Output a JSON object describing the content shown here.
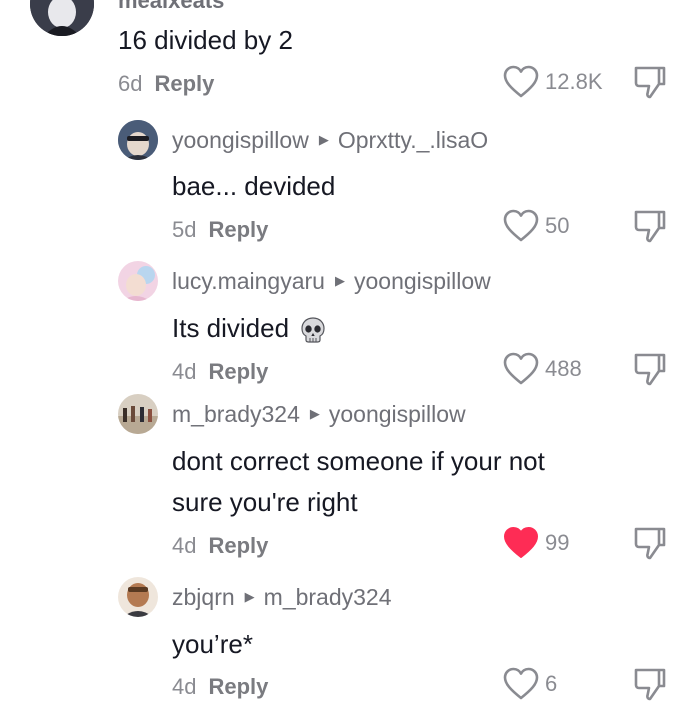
{
  "top_comment": {
    "username": "mealxeats",
    "text": "16 divided by 2",
    "age": "6d",
    "reply_label": "Reply",
    "likes": "12.8K"
  },
  "replies": [
    {
      "user": "yoongispillow",
      "reply_to": "Oprxtty._.lisaO",
      "text": "bae... devided",
      "age": "5d",
      "reply_label": "Reply",
      "likes": "50",
      "liked": false
    },
    {
      "user": "lucy.maingyaru",
      "reply_to": "yoongispillow",
      "text": "Its divided",
      "emoji_icon": "skull-icon",
      "age": "4d",
      "reply_label": "Reply",
      "likes": "488",
      "liked": false
    },
    {
      "user": "m_brady324",
      "reply_to": "yoongispillow",
      "text_line1": "dont correct someone if your not",
      "text_line2": "sure you're right",
      "age": "4d",
      "reply_label": "Reply",
      "likes": "99",
      "liked": true
    },
    {
      "user": "zbjqrn",
      "reply_to": "m_brady324",
      "text": "you’re*",
      "age": "4d",
      "reply_label": "Reply",
      "likes": "6",
      "liked": false
    }
  ],
  "colors": {
    "like_active": "#fe2c55",
    "text": "#161823",
    "muted": "#8a8b91"
  }
}
